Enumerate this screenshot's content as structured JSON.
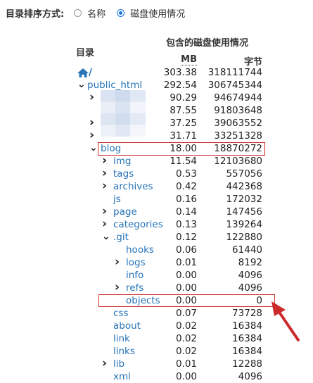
{
  "sort": {
    "label": "目录排序方式:",
    "options": [
      {
        "label": "名称",
        "checked": false
      },
      {
        "label": "磁盘使用情况",
        "checked": true
      }
    ]
  },
  "table": {
    "dir_header": "目录",
    "usage_header": "包含的磁盘使用情况",
    "mb_header": "MB",
    "bytes_header": "字节",
    "root_slash": "/",
    "rows": [
      {
        "name": "",
        "mb": "303.38",
        "bytes": "318111744"
      },
      {
        "name": "public_html",
        "mb": "292.54",
        "bytes": "306745344"
      },
      {
        "name": "",
        "mb": "90.29",
        "bytes": "94674944"
      },
      {
        "name": "",
        "mb": "87.55",
        "bytes": "91803648"
      },
      {
        "name": "",
        "mb": "37.25",
        "bytes": "39063552"
      },
      {
        "name": "",
        "mb": "31.71",
        "bytes": "33251328"
      },
      {
        "name": "blog",
        "mb": "18.00",
        "bytes": "18870272"
      },
      {
        "name": "img",
        "mb": "11.54",
        "bytes": "12103680"
      },
      {
        "name": "tags",
        "mb": "0.53",
        "bytes": "557056"
      },
      {
        "name": "archives",
        "mb": "0.42",
        "bytes": "442368"
      },
      {
        "name": "js",
        "mb": "0.16",
        "bytes": "172032"
      },
      {
        "name": "page",
        "mb": "0.14",
        "bytes": "147456"
      },
      {
        "name": "categories",
        "mb": "0.13",
        "bytes": "139264"
      },
      {
        "name": ".git",
        "mb": "0.12",
        "bytes": "122880"
      },
      {
        "name": "hooks",
        "mb": "0.06",
        "bytes": "61440"
      },
      {
        "name": "logs",
        "mb": "0.01",
        "bytes": "8192"
      },
      {
        "name": "info",
        "mb": "0.00",
        "bytes": "4096"
      },
      {
        "name": "refs",
        "mb": "0.00",
        "bytes": "4096"
      },
      {
        "name": "objects",
        "mb": "0.00",
        "bytes": "0"
      },
      {
        "name": "css",
        "mb": "0.07",
        "bytes": "73728"
      },
      {
        "name": "about",
        "mb": "0.02",
        "bytes": "16384"
      },
      {
        "name": "link",
        "mb": "0.02",
        "bytes": "16384"
      },
      {
        "name": "links",
        "mb": "0.02",
        "bytes": "16384"
      },
      {
        "name": "lib",
        "mb": "0.01",
        "bytes": "12288"
      },
      {
        "name": "xml",
        "mb": "0.00",
        "bytes": "4096"
      }
    ]
  },
  "colors": {
    "link": "#2774b8",
    "accent": "#1a73e8",
    "highlight": "#cc2b2b"
  }
}
